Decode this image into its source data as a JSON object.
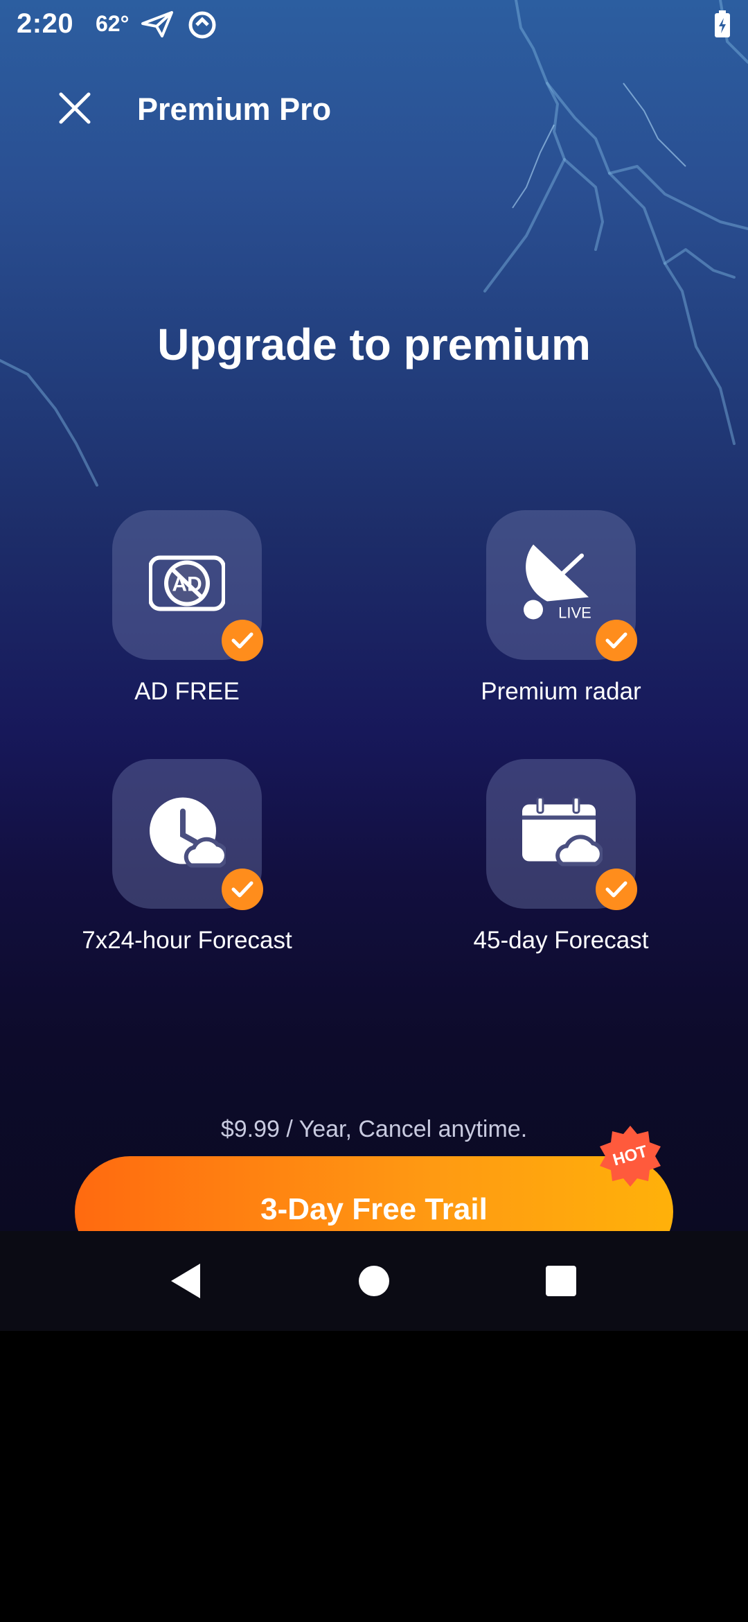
{
  "status_bar": {
    "time": "2:20",
    "temperature": "62°",
    "icons": [
      "send-icon",
      "circle-status-icon",
      "battery-charging-icon"
    ]
  },
  "header": {
    "title": "Premium Pro",
    "close_icon": "close-icon"
  },
  "hero": {
    "title": "Upgrade to premium"
  },
  "features": [
    {
      "label": "AD FREE",
      "icon": "ad-free-icon"
    },
    {
      "label": "Premium radar",
      "icon": "radar-dish-icon",
      "badge_text": "LIVE"
    },
    {
      "label": "7x24-hour Forecast",
      "icon": "clock-cloud-icon"
    },
    {
      "label": "45-day Forecast",
      "icon": "calendar-cloud-icon"
    }
  ],
  "pricing": {
    "text": "$9.99 / Year, Cancel anytime."
  },
  "cta": {
    "label": "3-Day Free Trail",
    "badge": "HOT"
  },
  "nav": {
    "back_icon": "back-triangle-icon",
    "home_icon": "home-circle-icon",
    "recents_icon": "recents-square-icon"
  },
  "colors": {
    "accent_orange": "#ff8d1c",
    "hot_badge": "#ff5a3c",
    "background_top": "#2c5ea0",
    "background_bottom": "#0a0a1e"
  }
}
